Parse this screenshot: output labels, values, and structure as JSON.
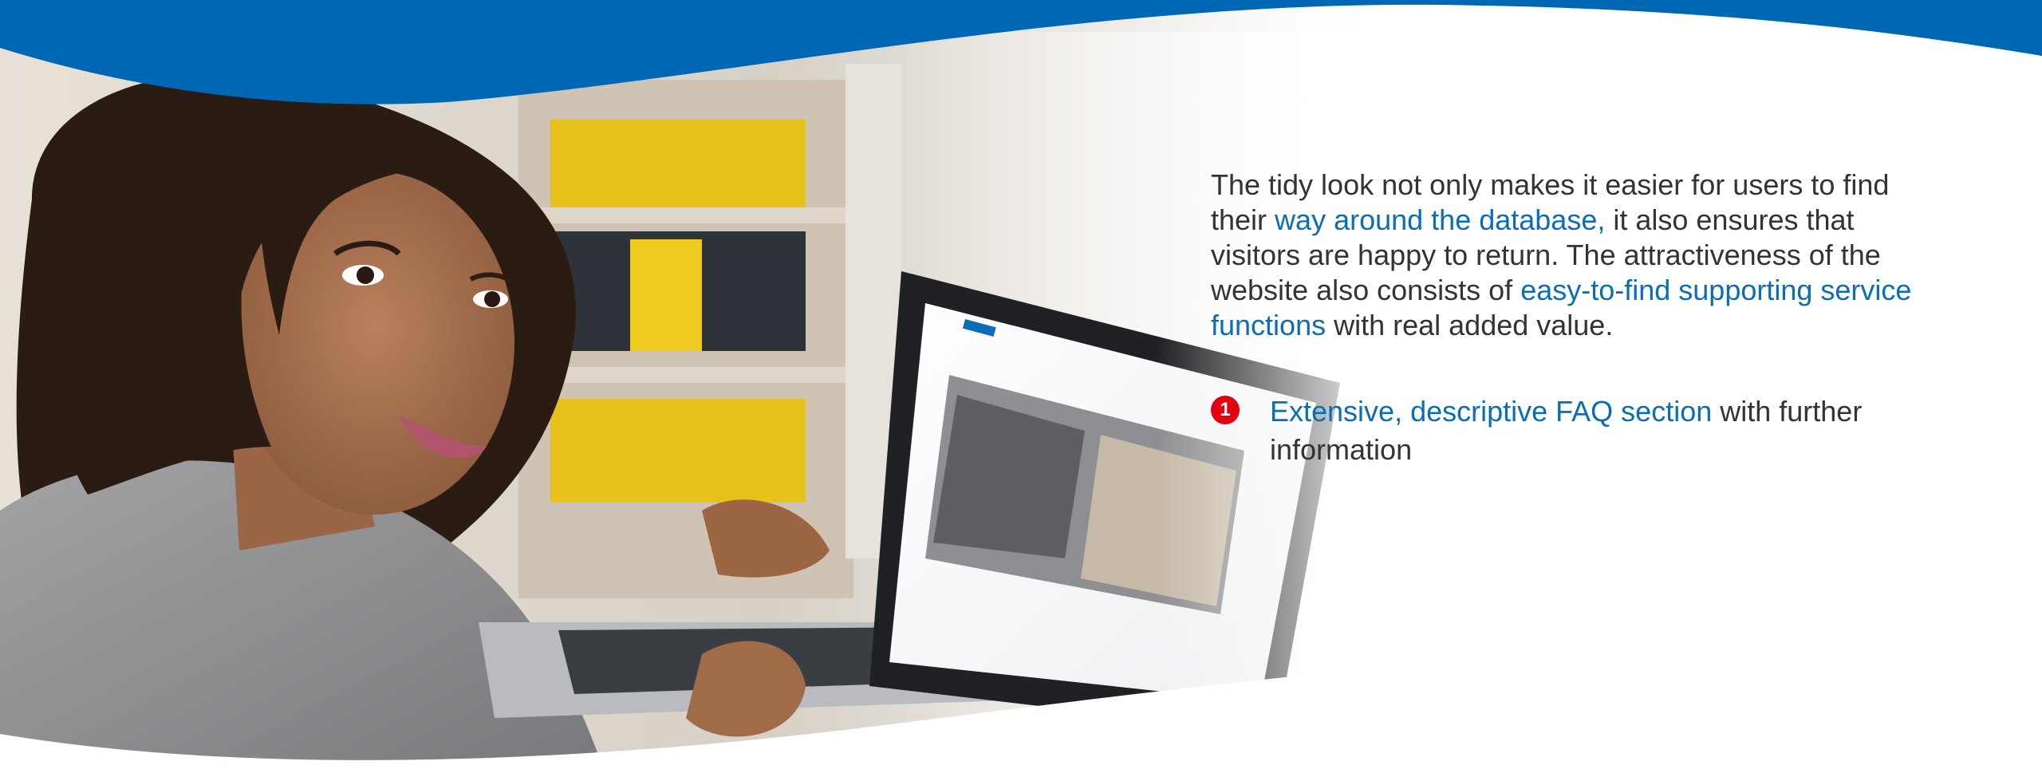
{
  "hero": {
    "image": "woman-with-laptop-photo",
    "screen": "faq-website-screenshot"
  },
  "intro": {
    "text_1": "The tidy look not only makes it easier for users to find their ",
    "link_1": "way around the database,",
    "text_2": " it also ensures that visitors are happy to return. The attractiveness of the website also consists of ",
    "link_2": "easy-to-find supporting service functions",
    "text_3": " with real added value."
  },
  "feature": {
    "number": "1",
    "link": "Extensive, descriptive FAQ section",
    "text": " with further information"
  },
  "colors": {
    "brand_blue": "#0067b4",
    "link_blue": "#0a6eb4",
    "badge_red": "#e3000f",
    "body_text": "#333333"
  }
}
